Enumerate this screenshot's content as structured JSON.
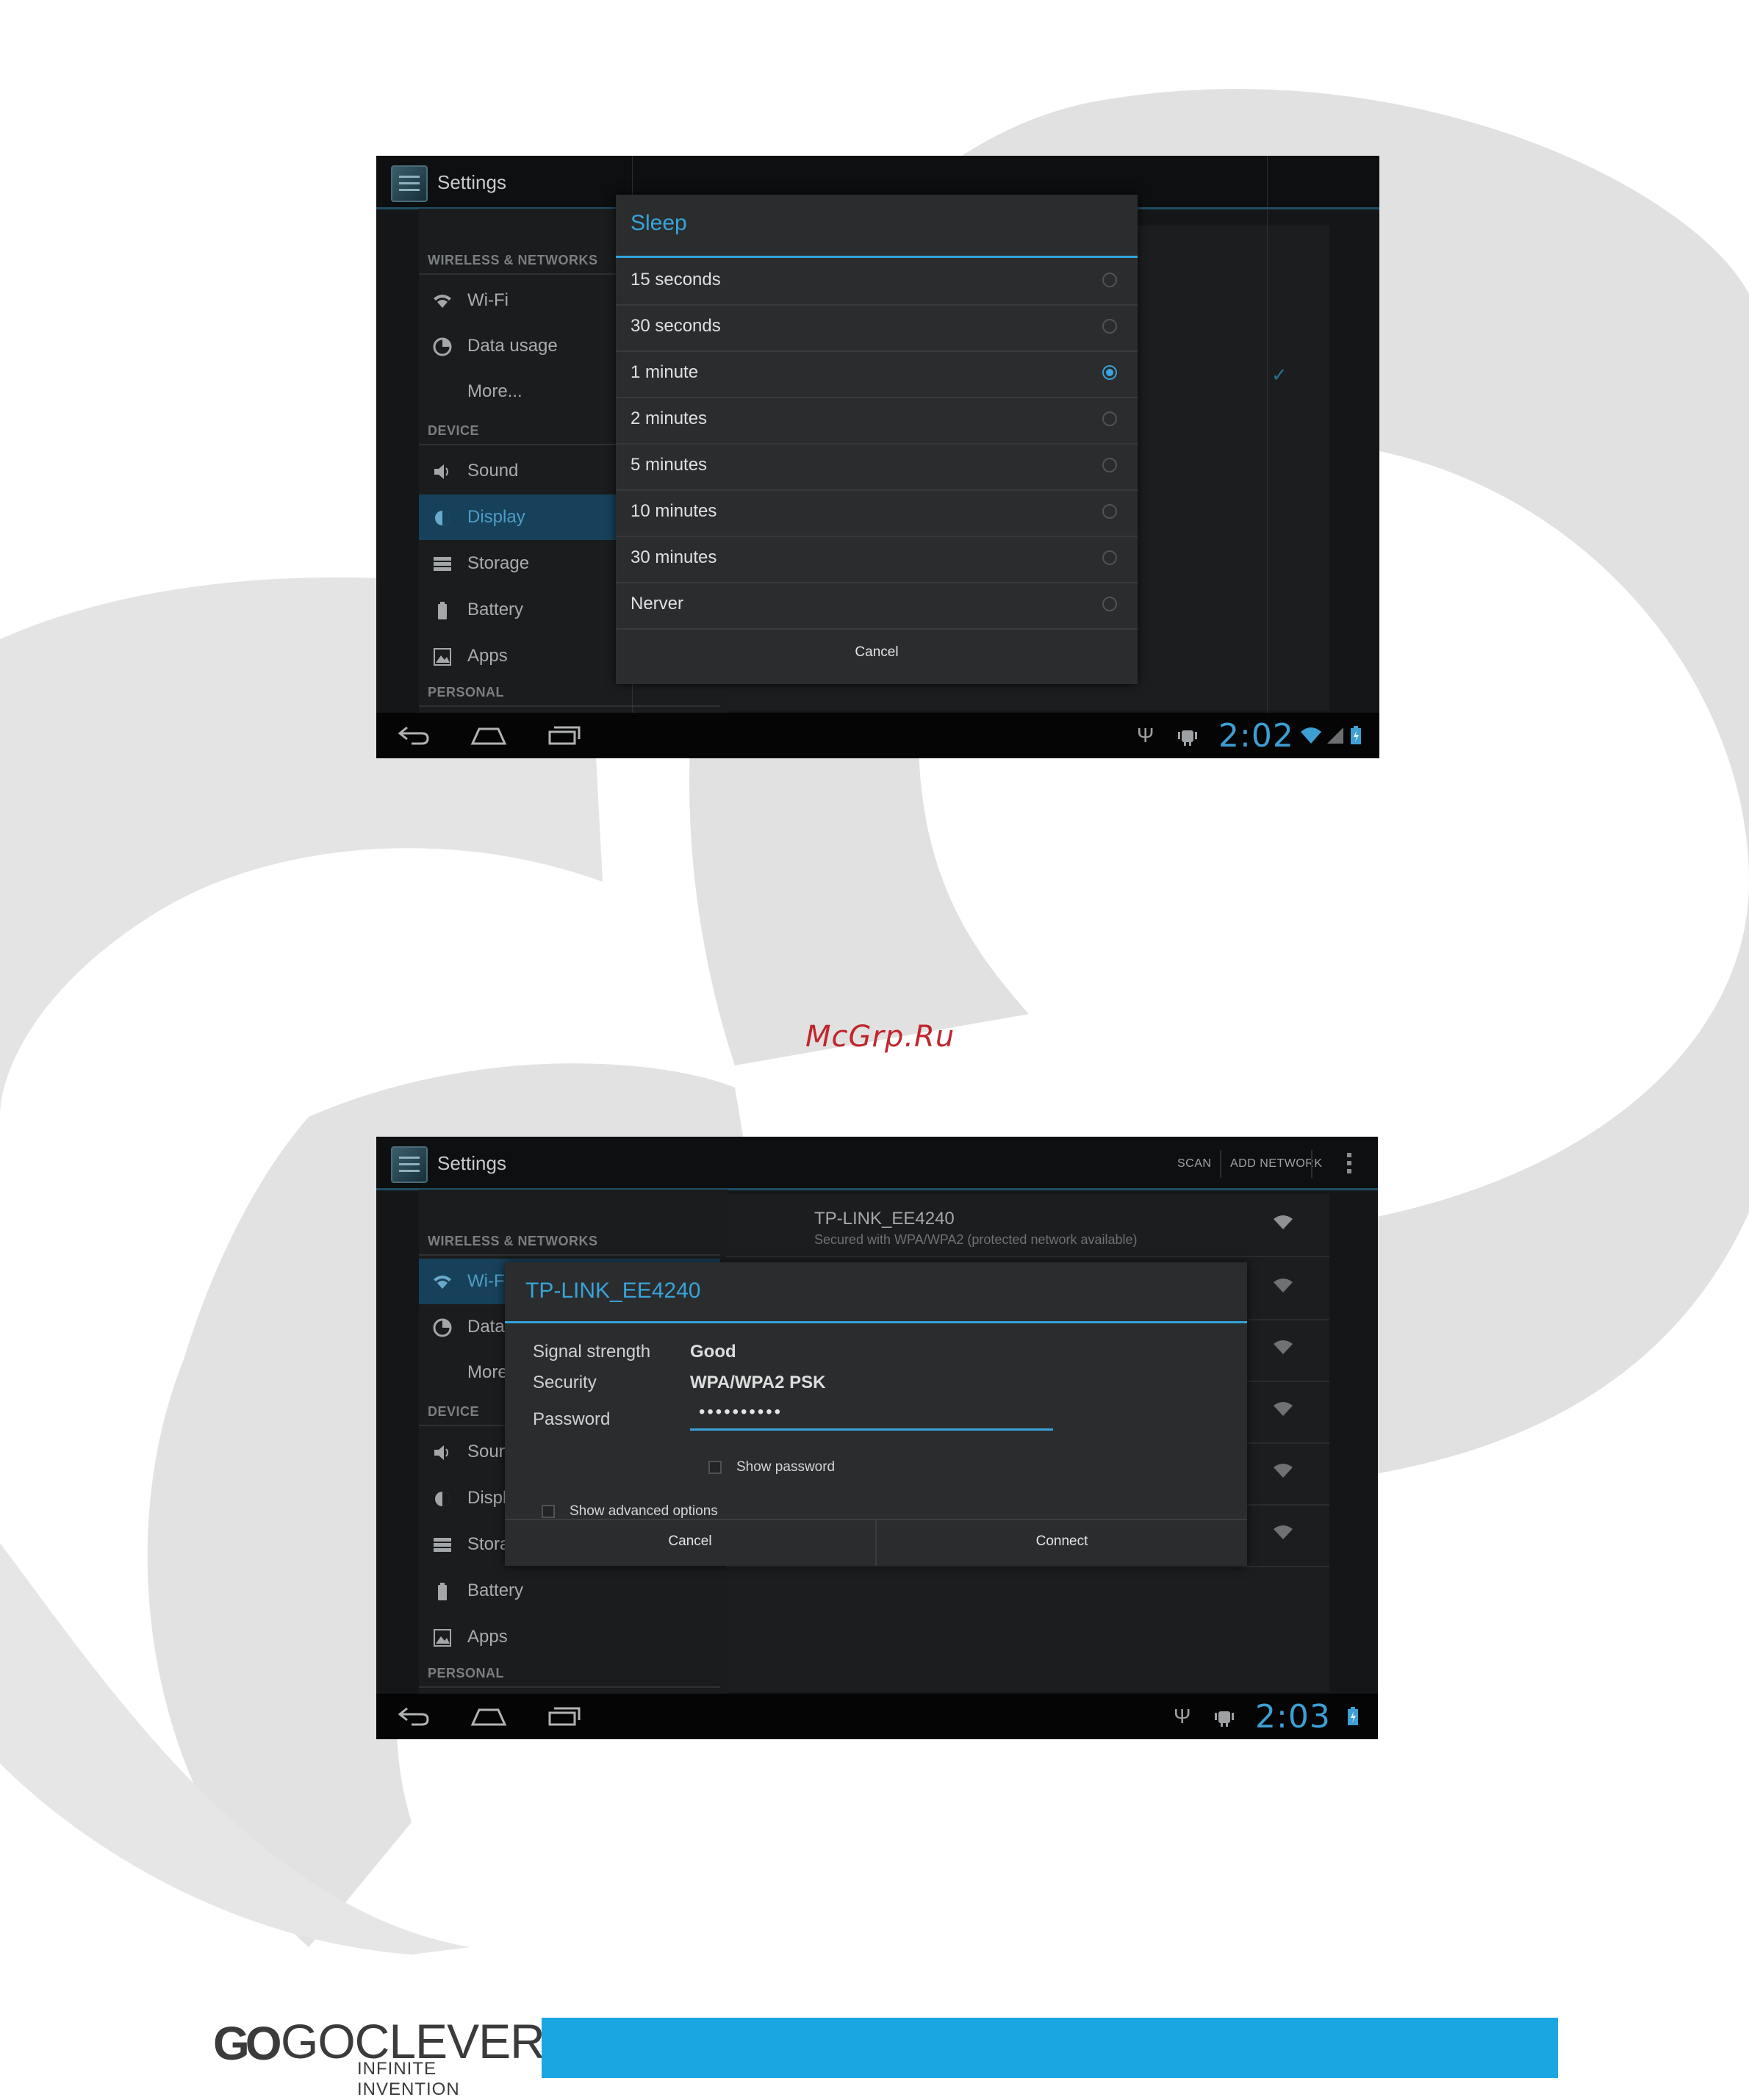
{
  "colors": {
    "accent": "#33a3d9",
    "footer_bar": "#1aa6e1",
    "watermark": "#c0262d"
  },
  "screen1": {
    "app_title": "Settings",
    "sidebar": {
      "sections": [
        {
          "header": "WIRELESS & NETWORKS",
          "items": [
            {
              "label": "Wi-Fi",
              "icon": "wifi-icon"
            },
            {
              "label": "Data usage",
              "icon": "data-usage-icon"
            },
            {
              "label": "More...",
              "icon": ""
            }
          ]
        },
        {
          "header": "DEVICE",
          "items": [
            {
              "label": "Sound",
              "icon": "speaker-icon"
            },
            {
              "label": "Display",
              "icon": "brightness-icon",
              "selected": true
            },
            {
              "label": "Storage",
              "icon": "storage-icon"
            },
            {
              "label": "Battery",
              "icon": "battery-icon"
            },
            {
              "label": "Apps",
              "icon": "apps-icon"
            }
          ]
        },
        {
          "header": "PERSONAL",
          "items": []
        }
      ]
    },
    "dialog": {
      "title": "Sleep",
      "options": [
        "15 seconds",
        "30 seconds",
        "1 minute",
        "2 minutes",
        "5 minutes",
        "10 minutes",
        "30 minutes",
        "Nerver"
      ],
      "selected": "1 minute",
      "cancel_label": "Cancel"
    },
    "status_bar": {
      "time": "2:02",
      "icons": [
        "usb-icon",
        "android-debug-icon",
        "wifi-signal-icon",
        "cell-signal-icon",
        "battery-charging-icon"
      ]
    }
  },
  "watermark": "McGrp.Ru",
  "screen2": {
    "app_title": "Settings",
    "actions": {
      "scan_label": "SCAN",
      "add_network_label": "ADD NETWORK"
    },
    "sidebar": {
      "sections": [
        {
          "header": "WIRELESS & NETWORKS",
          "items": [
            {
              "label": "Wi-Fi",
              "icon": "wifi-icon",
              "selected": true
            },
            {
              "label": "Data usage",
              "icon": "data-usage-icon"
            },
            {
              "label": "More...",
              "icon": ""
            }
          ]
        },
        {
          "header": "DEVICE",
          "items": [
            {
              "label": "Sound",
              "icon": "speaker-icon"
            },
            {
              "label": "Display",
              "icon": "brightness-icon"
            },
            {
              "label": "Storage",
              "icon": "storage-icon"
            },
            {
              "label": "Battery",
              "icon": "battery-icon"
            },
            {
              "label": "Apps",
              "icon": "apps-icon"
            }
          ]
        },
        {
          "header": "PERSONAL",
          "items": []
        }
      ]
    },
    "networks": [
      {
        "name": "TP-LINK_EE4240",
        "status": "Secured with WPA/WPA2 (protected network available)"
      }
    ],
    "dialog": {
      "title": "TP-LINK_EE4240",
      "signal_strength_label": "Signal strength",
      "signal_strength_value": "Good",
      "security_label": "Security",
      "security_value": "WPA/WPA2 PSK",
      "password_label": "Password",
      "password_value": "••••••••••",
      "show_password_label": "Show password",
      "show_advanced_label": "Show advanced options",
      "cancel_label": "Cancel",
      "connect_label": "Connect"
    },
    "status_bar": {
      "time": "2:03",
      "icons": [
        "usb-icon",
        "android-debug-icon",
        "battery-charging-icon"
      ]
    }
  },
  "footer": {
    "logo_mark": "GO",
    "brand": "GOCLEVER",
    "tagline": "INFINITE INVENTION"
  }
}
